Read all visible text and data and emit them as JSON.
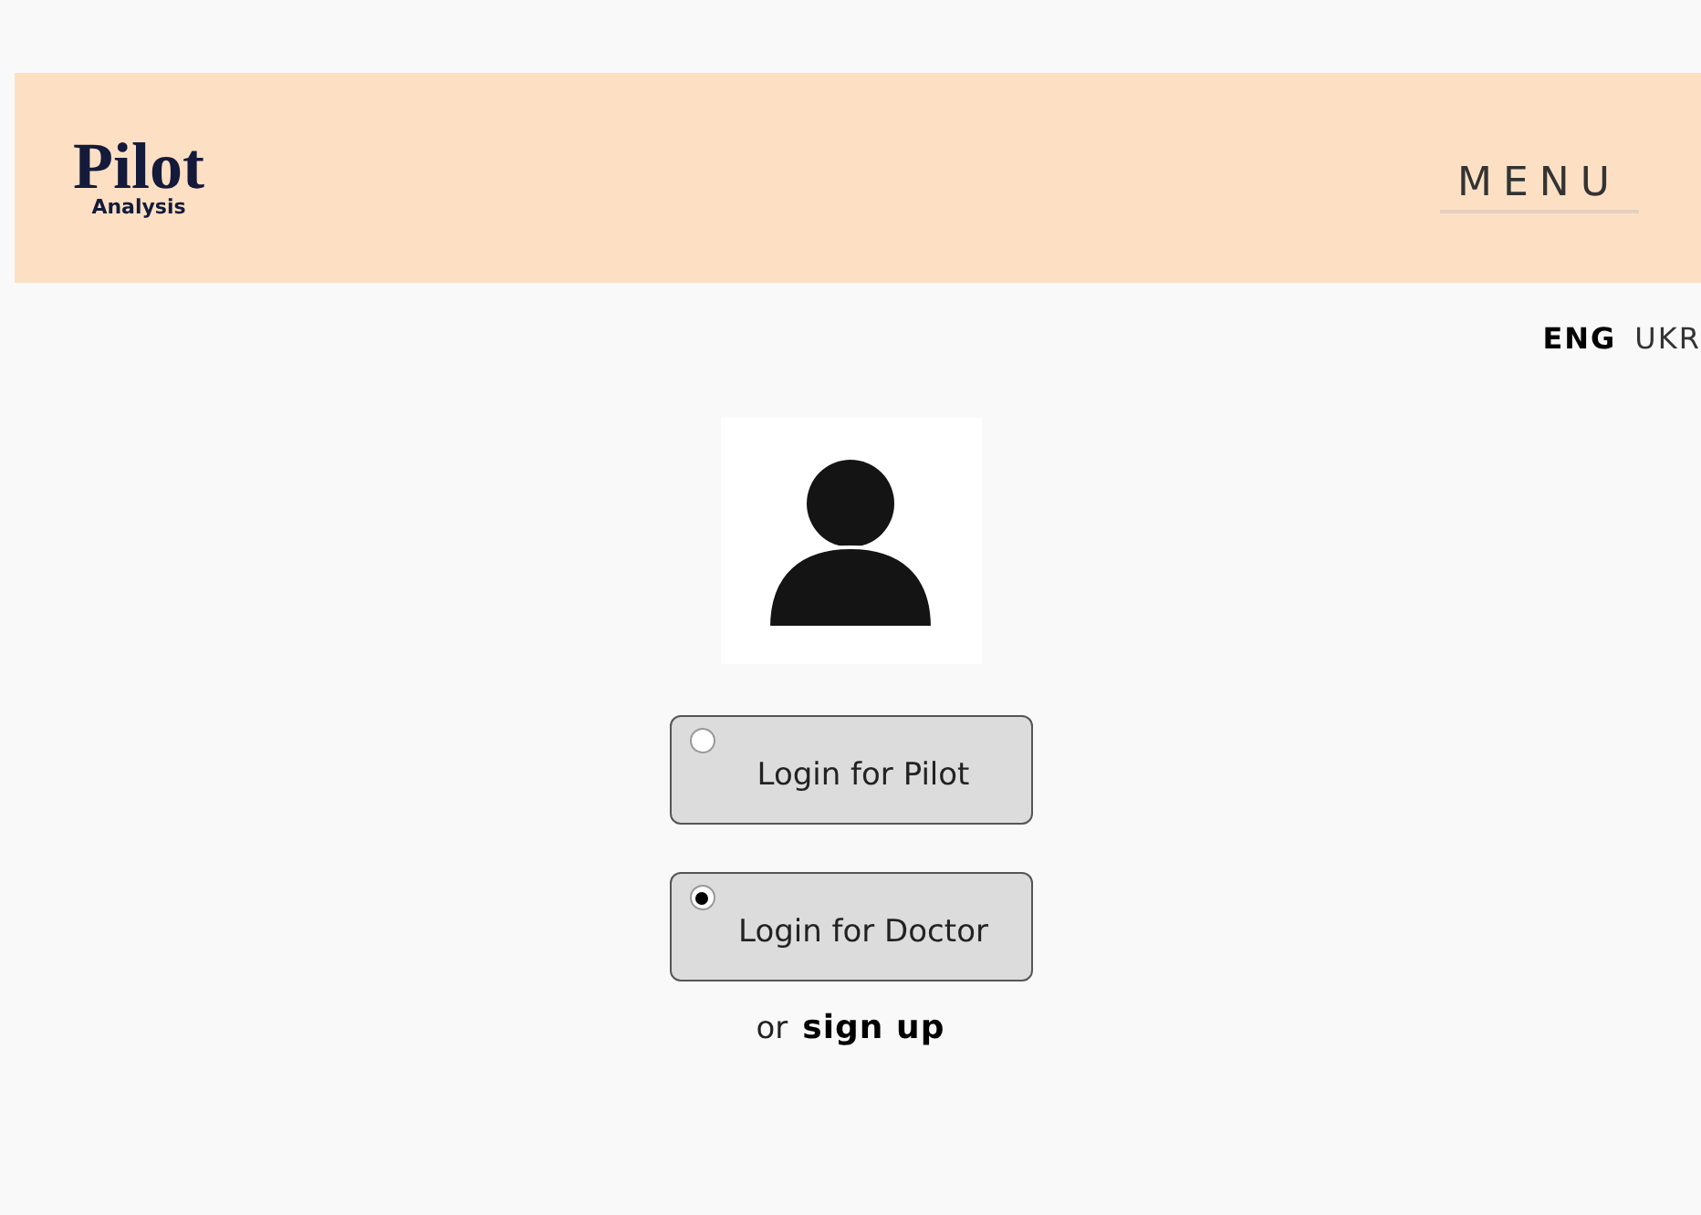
{
  "header": {
    "logo": "Pilot",
    "logo_subtitle": "Analysis",
    "menu": "MENU"
  },
  "languages": [
    {
      "label": "ENG",
      "selected": true
    },
    {
      "label": "UKR",
      "selected": false
    }
  ],
  "login_options": [
    {
      "label": "Login for Pilot",
      "selected": false
    },
    {
      "label": "Login for Doctor",
      "selected": true
    }
  ],
  "signup": {
    "prefix": "or",
    "link": "sign up"
  }
}
